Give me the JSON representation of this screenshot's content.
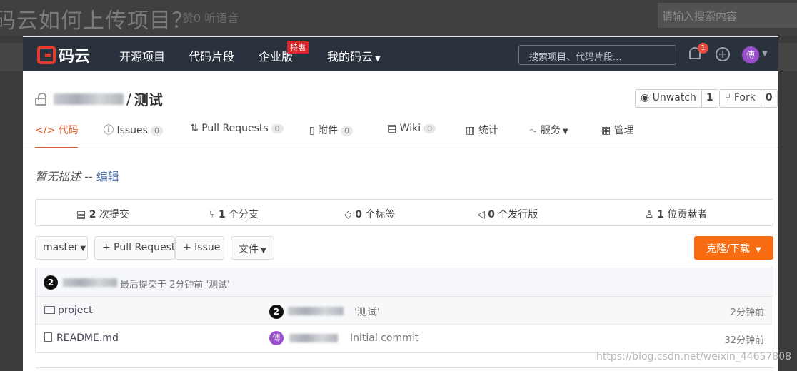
{
  "background": {
    "title": "码云如何上传项目？",
    "meta": "赞0  听语音",
    "search_placeholder": "请输入搜索内容"
  },
  "nav": {
    "logo_text": "码云",
    "links": [
      "开源项目",
      "代码片段",
      "企业版",
      "我的码云"
    ],
    "enterprise_badge": "特惠",
    "search_placeholder": "搜索项目、代码片段...",
    "notification_count": "1",
    "avatar_text": "傅"
  },
  "repo": {
    "separator": "/",
    "name": "测试",
    "watch_label": "Unwatch",
    "watch_count": "1",
    "fork_label": "Fork",
    "fork_count": "0"
  },
  "tabs": [
    {
      "label": "代码",
      "count": null
    },
    {
      "label": "Issues",
      "count": "0"
    },
    {
      "label": "Pull Requests",
      "count": "0"
    },
    {
      "label": "附件",
      "count": "0"
    },
    {
      "label": "Wiki",
      "count": "0"
    },
    {
      "label": "统计",
      "count": null
    },
    {
      "label": "服务",
      "count": null
    },
    {
      "label": "管理",
      "count": null
    }
  ],
  "description": {
    "text": "暂无描述 --",
    "edit": "编辑"
  },
  "stats": {
    "commits_num": "2",
    "commits_label": "次提交",
    "branches_num": "1",
    "branches_label": "个分支",
    "tags_num": "0",
    "tags_label": "个标签",
    "releases_num": "0",
    "releases_label": "个发行版",
    "contributors_num": "1",
    "contributors_label": "位贡献者"
  },
  "toolbar": {
    "branch": "master",
    "pull_request": "+ Pull Request",
    "issue": "+ Issue",
    "file": "文件",
    "clone": "克隆/下载"
  },
  "latest_commit": {
    "badge": "2",
    "text": "最后提交于 2分钟前 '测试'"
  },
  "files": [
    {
      "name": "project",
      "type": "folder",
      "badge": "2",
      "message": "'测试'",
      "time": "2分钟前"
    },
    {
      "name": "README.md",
      "type": "file",
      "avatar": "傅",
      "message": "Initial commit",
      "time": "32分钟前"
    }
  ],
  "watermark": "https://blog.csdn.net/weixin_44657808",
  "colors": {
    "accent": "#f76b12",
    "nav_bg": "#2a323d",
    "logo_red": "#e43b2c"
  }
}
